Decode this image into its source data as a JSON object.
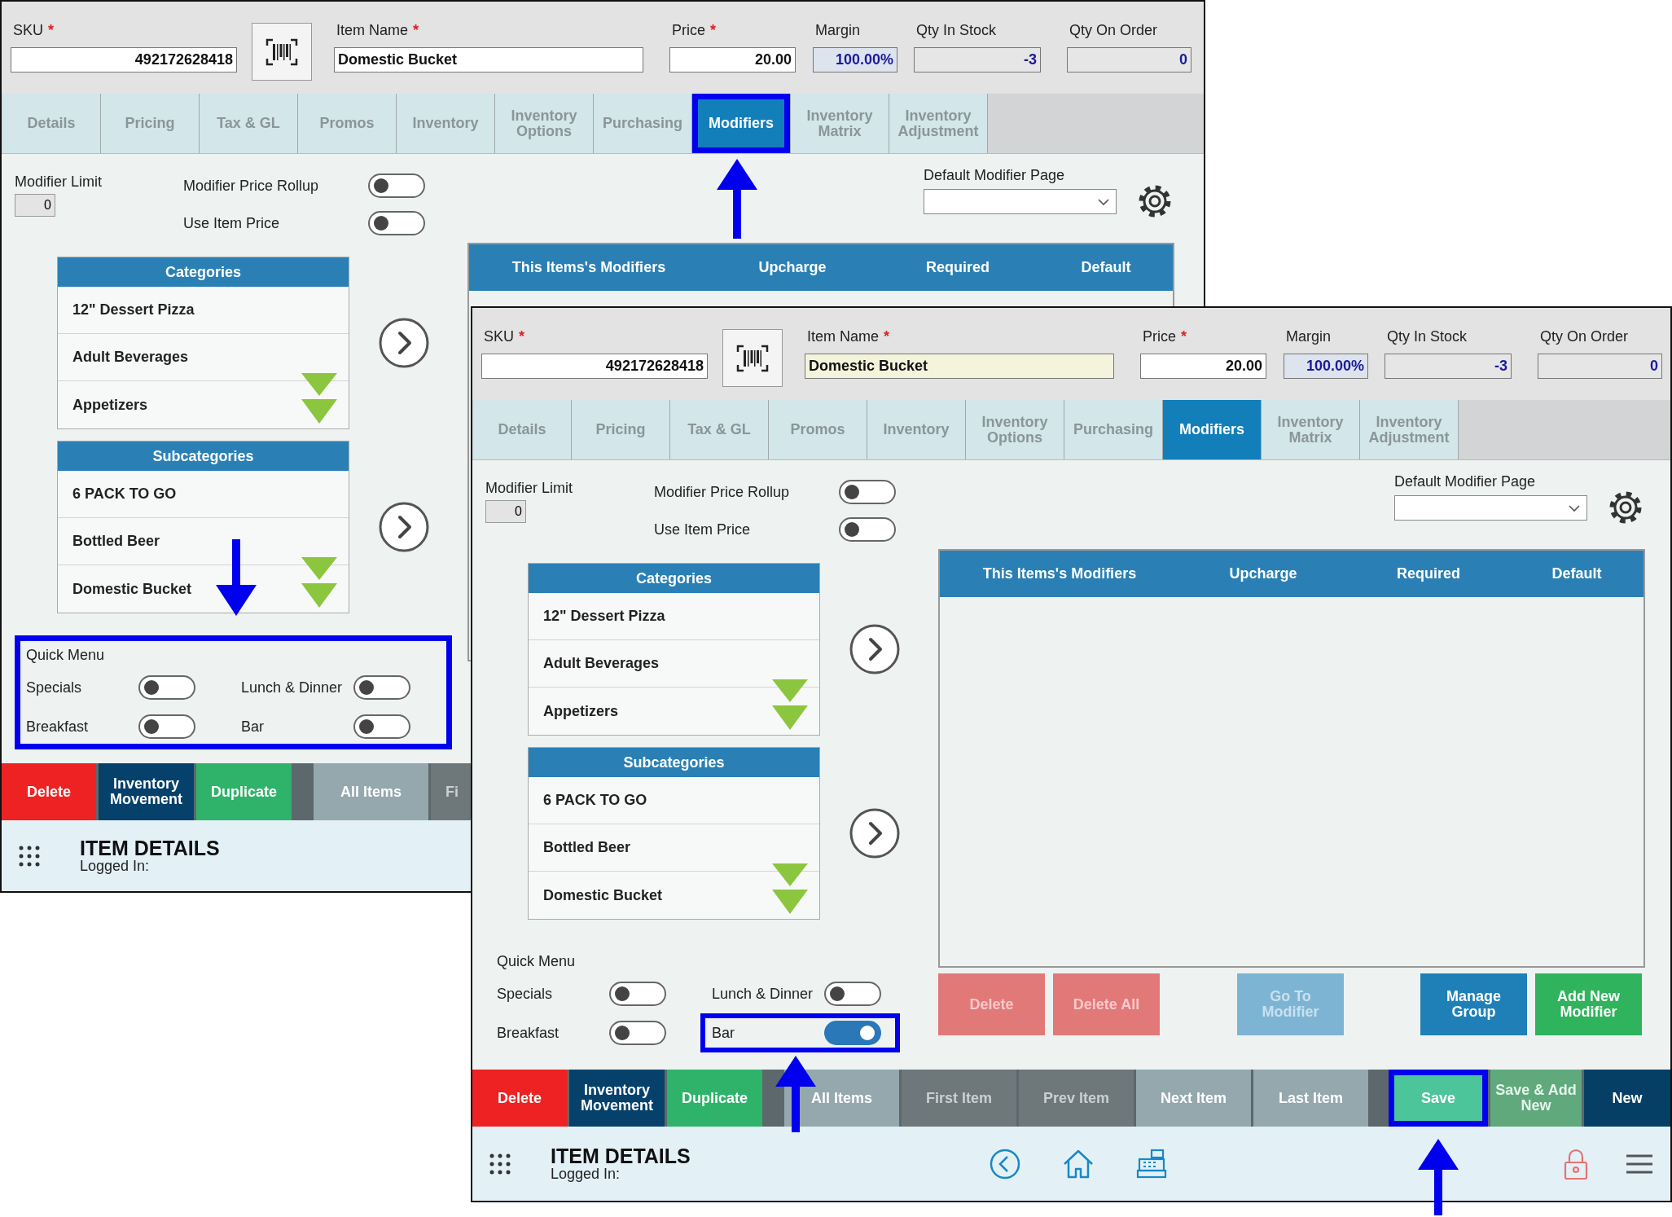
{
  "windows": [
    {
      "kind": "back",
      "fields": [
        {
          "kind": "sku",
          "label": "SKU",
          "marker": "*",
          "value": "492172628418",
          "focused": false
        },
        {
          "kind": "name",
          "label": "Item Name",
          "marker": "*",
          "value": "Domestic Bucket",
          "focused": false
        },
        {
          "kind": "price",
          "label": "Price",
          "marker": "*",
          "value": "20.00",
          "focused": false
        },
        {
          "kind": "margin",
          "label": "Margin",
          "value": "100.00%"
        },
        {
          "kind": "stock",
          "label": "Qty In Stock",
          "value": "-3"
        },
        {
          "kind": "order",
          "label": "Qty On Order",
          "value": "0"
        }
      ],
      "tabs": [
        {
          "label": "Details",
          "selected": false,
          "highlighted": false
        },
        {
          "label": "Pricing",
          "selected": false,
          "highlighted": false
        },
        {
          "label": "Tax & GL",
          "selected": false,
          "highlighted": false
        },
        {
          "label": "Promos",
          "selected": false,
          "highlighted": false
        },
        {
          "label": "Inventory",
          "selected": false,
          "highlighted": false
        },
        {
          "label": "Inventory Options",
          "selected": false,
          "highlighted": false
        },
        {
          "label": "Purchasing",
          "selected": false,
          "highlighted": false
        },
        {
          "label": "Modifiers",
          "selected": true,
          "highlighted": true
        },
        {
          "label": "Inventory Matrix",
          "selected": false,
          "highlighted": false
        },
        {
          "label": "Inventory Adjustment",
          "selected": false,
          "highlighted": false
        }
      ],
      "modifier_limit": {
        "label": "Modifier Limit",
        "value": "0"
      },
      "switches": [
        {
          "label": "Modifier Price Rollup",
          "on": false
        },
        {
          "label": "Use Item Price",
          "on": false
        }
      ],
      "default_modifier_page": {
        "label": "Default Modifier Page"
      },
      "lists": [
        {
          "title": "Categories",
          "items": [
            "12\" Dessert Pizza",
            "Adult Beverages",
            "Appetizers"
          ]
        },
        {
          "title": "Subcategories",
          "items": [
            "6 PACK TO GO",
            "Bottled Beer",
            "Domestic Bucket"
          ]
        }
      ],
      "modifiers_table": {
        "columns": [
          "This Items's Modifiers",
          "Upcharge",
          "Required",
          "Default"
        ]
      },
      "quick_menu": {
        "title": "Quick Menu",
        "highlighted": true,
        "items": [
          {
            "label": "Specials",
            "on": false,
            "highlighted": false
          },
          {
            "label": "Lunch & Dinner",
            "on": false,
            "highlighted": false
          },
          {
            "label": "Breakfast",
            "on": false,
            "highlighted": false
          },
          {
            "label": "Bar",
            "on": false,
            "highlighted": false
          }
        ]
      },
      "action_bar": [
        {
          "label": "Delete",
          "kind": "delete",
          "highlighted": false
        },
        {
          "label": "Inventory Movement",
          "kind": "movement",
          "highlighted": false
        },
        {
          "label": "Duplicate",
          "kind": "duplicate",
          "highlighted": false
        },
        {
          "label": "All Items",
          "kind": "nav",
          "disabled": false,
          "highlighted": false
        },
        {
          "label": "Fi",
          "kind": "partial",
          "disabled": true,
          "highlighted": false
        }
      ],
      "footer": {
        "title": "ITEM DETAILS",
        "subtitle": "Logged In:"
      }
    },
    {
      "kind": "front",
      "fields": [
        {
          "kind": "sku",
          "label": "SKU",
          "marker": "*",
          "value": "492172628418",
          "focused": false
        },
        {
          "kind": "name",
          "label": "Item Name",
          "marker": "*",
          "value": "Domestic Bucket",
          "focused": true
        },
        {
          "kind": "price",
          "label": "Price",
          "marker": "*",
          "value": "20.00",
          "focused": false
        },
        {
          "kind": "margin",
          "label": "Margin",
          "value": "100.00%"
        },
        {
          "kind": "stock",
          "label": "Qty In Stock",
          "value": "-3"
        },
        {
          "kind": "order",
          "label": "Qty On Order",
          "value": "0"
        }
      ],
      "tabs": [
        {
          "label": "Details",
          "selected": false,
          "highlighted": false
        },
        {
          "label": "Pricing",
          "selected": false,
          "highlighted": false
        },
        {
          "label": "Tax & GL",
          "selected": false,
          "highlighted": false
        },
        {
          "label": "Promos",
          "selected": false,
          "highlighted": false
        },
        {
          "label": "Inventory",
          "selected": false,
          "highlighted": false
        },
        {
          "label": "Inventory Options",
          "selected": false,
          "highlighted": false
        },
        {
          "label": "Purchasing",
          "selected": false,
          "highlighted": false
        },
        {
          "label": "Modifiers",
          "selected": true,
          "highlighted": false
        },
        {
          "label": "Inventory Matrix",
          "selected": false,
          "highlighted": false
        },
        {
          "label": "Inventory Adjustment",
          "selected": false,
          "highlighted": false
        }
      ],
      "modifier_limit": {
        "label": "Modifier Limit",
        "value": "0"
      },
      "switches": [
        {
          "label": "Modifier Price Rollup",
          "on": false
        },
        {
          "label": "Use Item Price",
          "on": false
        }
      ],
      "default_modifier_page": {
        "label": "Default Modifier Page"
      },
      "lists": [
        {
          "title": "Categories",
          "items": [
            "12\" Dessert Pizza",
            "Adult Beverages",
            "Appetizers"
          ]
        },
        {
          "title": "Subcategories",
          "items": [
            "6 PACK TO GO",
            "Bottled Beer",
            "Domestic Bucket"
          ]
        }
      ],
      "modifiers_table": {
        "columns": [
          "This Items's Modifiers",
          "Upcharge",
          "Required",
          "Default"
        ]
      },
      "table_buttons": [
        {
          "label": "Delete",
          "kind": "danger",
          "disabled": true
        },
        {
          "label": "Delete All",
          "kind": "danger",
          "disabled": true
        },
        {
          "label": "Go To Modifier",
          "kind": "info",
          "disabled": true
        },
        {
          "label": "Manage Group",
          "kind": "info",
          "disabled": false
        },
        {
          "label": "Add New Modifier",
          "kind": "success",
          "disabled": false
        }
      ],
      "quick_menu": {
        "title": "Quick Menu",
        "highlighted": false,
        "items": [
          {
            "label": "Specials",
            "on": false,
            "highlighted": false
          },
          {
            "label": "Lunch & Dinner",
            "on": false,
            "highlighted": false
          },
          {
            "label": "Breakfast",
            "on": false,
            "highlighted": false
          },
          {
            "label": "Bar",
            "on": true,
            "highlighted": true
          }
        ]
      },
      "action_bar": [
        {
          "label": "Delete",
          "kind": "delete",
          "highlighted": false
        },
        {
          "label": "Inventory Movement",
          "kind": "movement",
          "highlighted": false
        },
        {
          "label": "Duplicate",
          "kind": "duplicate",
          "highlighted": false
        },
        {
          "label": "All Items",
          "kind": "nav",
          "disabled": false,
          "highlighted": false
        },
        {
          "label": "First Item",
          "kind": "nav",
          "disabled": true,
          "highlighted": false
        },
        {
          "label": "Prev Item",
          "kind": "nav",
          "disabled": true,
          "highlighted": false
        },
        {
          "label": "Next Item",
          "kind": "nav",
          "disabled": false,
          "highlighted": false
        },
        {
          "label": "Last Item",
          "kind": "nav",
          "disabled": false,
          "highlighted": false
        },
        {
          "label": "Save",
          "kind": "save",
          "disabled": false,
          "highlighted": true
        },
        {
          "label": "Save & Add New",
          "kind": "save_new",
          "disabled": true,
          "highlighted": false
        },
        {
          "label": "New",
          "kind": "new",
          "highlighted": false
        }
      ],
      "footer": {
        "title": "ITEM DETAILS",
        "subtitle": "Logged In:",
        "nav_icons": true
      }
    }
  ]
}
